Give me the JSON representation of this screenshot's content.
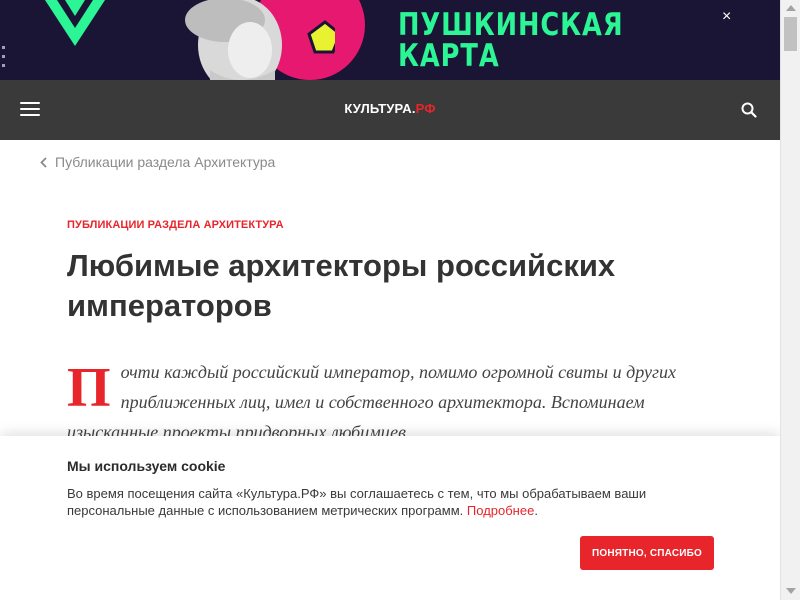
{
  "banner": {
    "headline_line1": "ПУШКИНСКАЯ",
    "headline_line2": "КАРТА",
    "close_glyph": "×",
    "colors": {
      "background": "#1a1535",
      "text": "#2cf596",
      "accent_pink": "#e6186f",
      "pentagon": "#e8f230"
    }
  },
  "header": {
    "logo_main": "КУЛЬТУРА.",
    "logo_accent": "РФ",
    "menu_icon": "hamburger-menu-icon",
    "search_icon": "search-icon",
    "colors": {
      "background": "#3a3a3a",
      "accent": "#e8252b"
    }
  },
  "breadcrumb": {
    "label": "Публикации раздела Архитектура",
    "icon": "chevron-left-icon"
  },
  "article": {
    "rubric": "ПУБЛИКАЦИИ РАЗДЕЛА АРХИТЕКТУРА",
    "title": "Любимые архитекторы российских императоров",
    "drop_cap": "П",
    "lead": "очти каждый российский император, помимо огромной свиты и других приближенных лиц, имел и собственного архитектора. Вспоминаем изысканные проекты придворных любимцев."
  },
  "cookie": {
    "title": "Мы используем cookie",
    "text": "Во время посещения сайта «Культура.РФ» вы соглашаетесь с тем, что мы обрабатываем ваши персональные данные с использованием метрических программ.",
    "link": "Подробнее",
    "link_suffix": ".",
    "button": "ПОНЯТНО, СПАСИБО"
  }
}
